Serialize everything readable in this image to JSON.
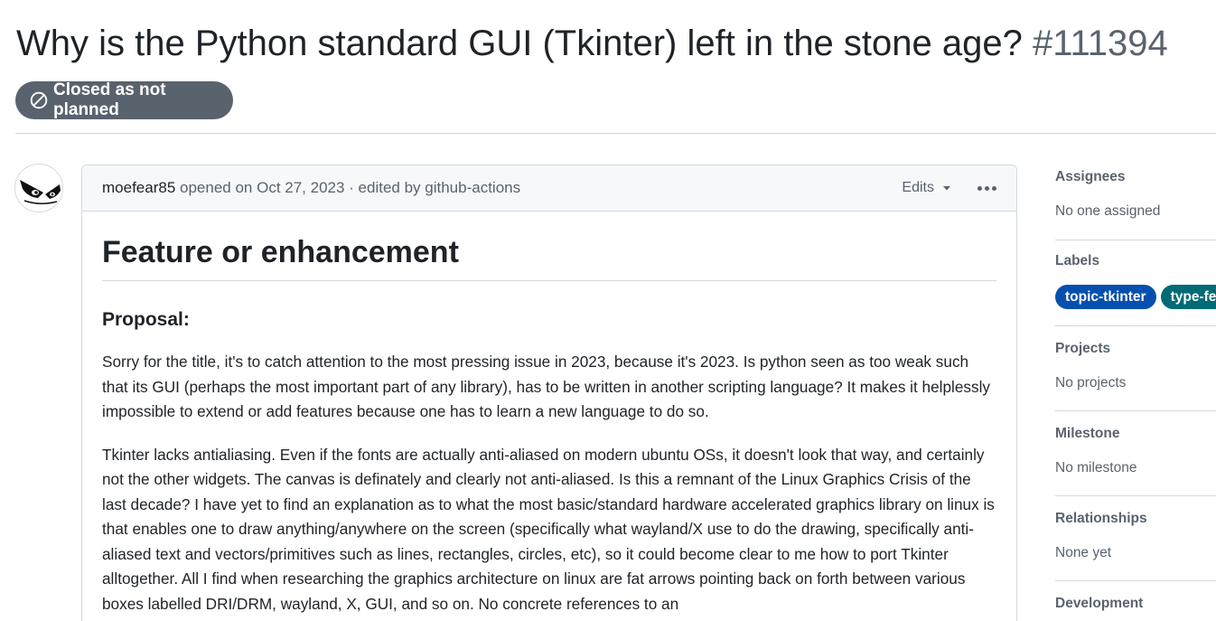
{
  "issue": {
    "title": "Why is the Python standard GUI (Tkinter) left in the stone age?",
    "number": "#111394",
    "state_label": "Closed as not planned",
    "state_color": "#59636e"
  },
  "comment": {
    "author": "moefear85",
    "meta": "opened on Oct 27, 2023 · edited by github-actions",
    "edits_label": "Edits",
    "heading": "Feature or enhancement",
    "subheading": "Proposal:",
    "paragraphs": [
      "Sorry for the title, it's to catch attention to the most pressing issue in 2023, because it's 2023. Is python seen as too weak such that its GUI (perhaps the most important part of any library), has to be written in another scripting language? It makes it helplessly impossible to extend or add features because one has to learn a new language to do so.",
      "Tkinter lacks antialiasing. Even if the fonts are actually anti-aliased on modern ubuntu OSs, it doesn't look that way, and certainly not the other widgets. The canvas is definately and clearly not anti-aliased. Is this a remnant of the Linux Graphics Crisis of the last decade? I have yet to find an explanation as to what the most basic/standard hardware accelerated graphics library on linux is that enables one to draw anything/anywhere on the screen (specifically what wayland/X use to do the drawing, specifically anti-aliased text and vectors/primitives such as lines, rectangles, circles, etc), so it could become clear to me how to port Tkinter alltogether. All I find when researching the graphics architecture on linux are fat arrows pointing back on forth between various boxes labelled DRI/DRM, wayland, X, GUI, and so on. No concrete references to an"
    ]
  },
  "sidebar": {
    "assignees": {
      "heading": "Assignees",
      "value": "No one assigned"
    },
    "labels": {
      "heading": "Labels",
      "items": [
        {
          "text": "topic-tkinter",
          "color": "#0550ae"
        },
        {
          "text": "type-feature",
          "color": "#006b75"
        }
      ]
    },
    "projects": {
      "heading": "Projects",
      "value": "No projects"
    },
    "milestone": {
      "heading": "Milestone",
      "value": "No milestone"
    },
    "relationships": {
      "heading": "Relationships",
      "value": "None yet"
    },
    "development": {
      "heading": "Development"
    }
  }
}
